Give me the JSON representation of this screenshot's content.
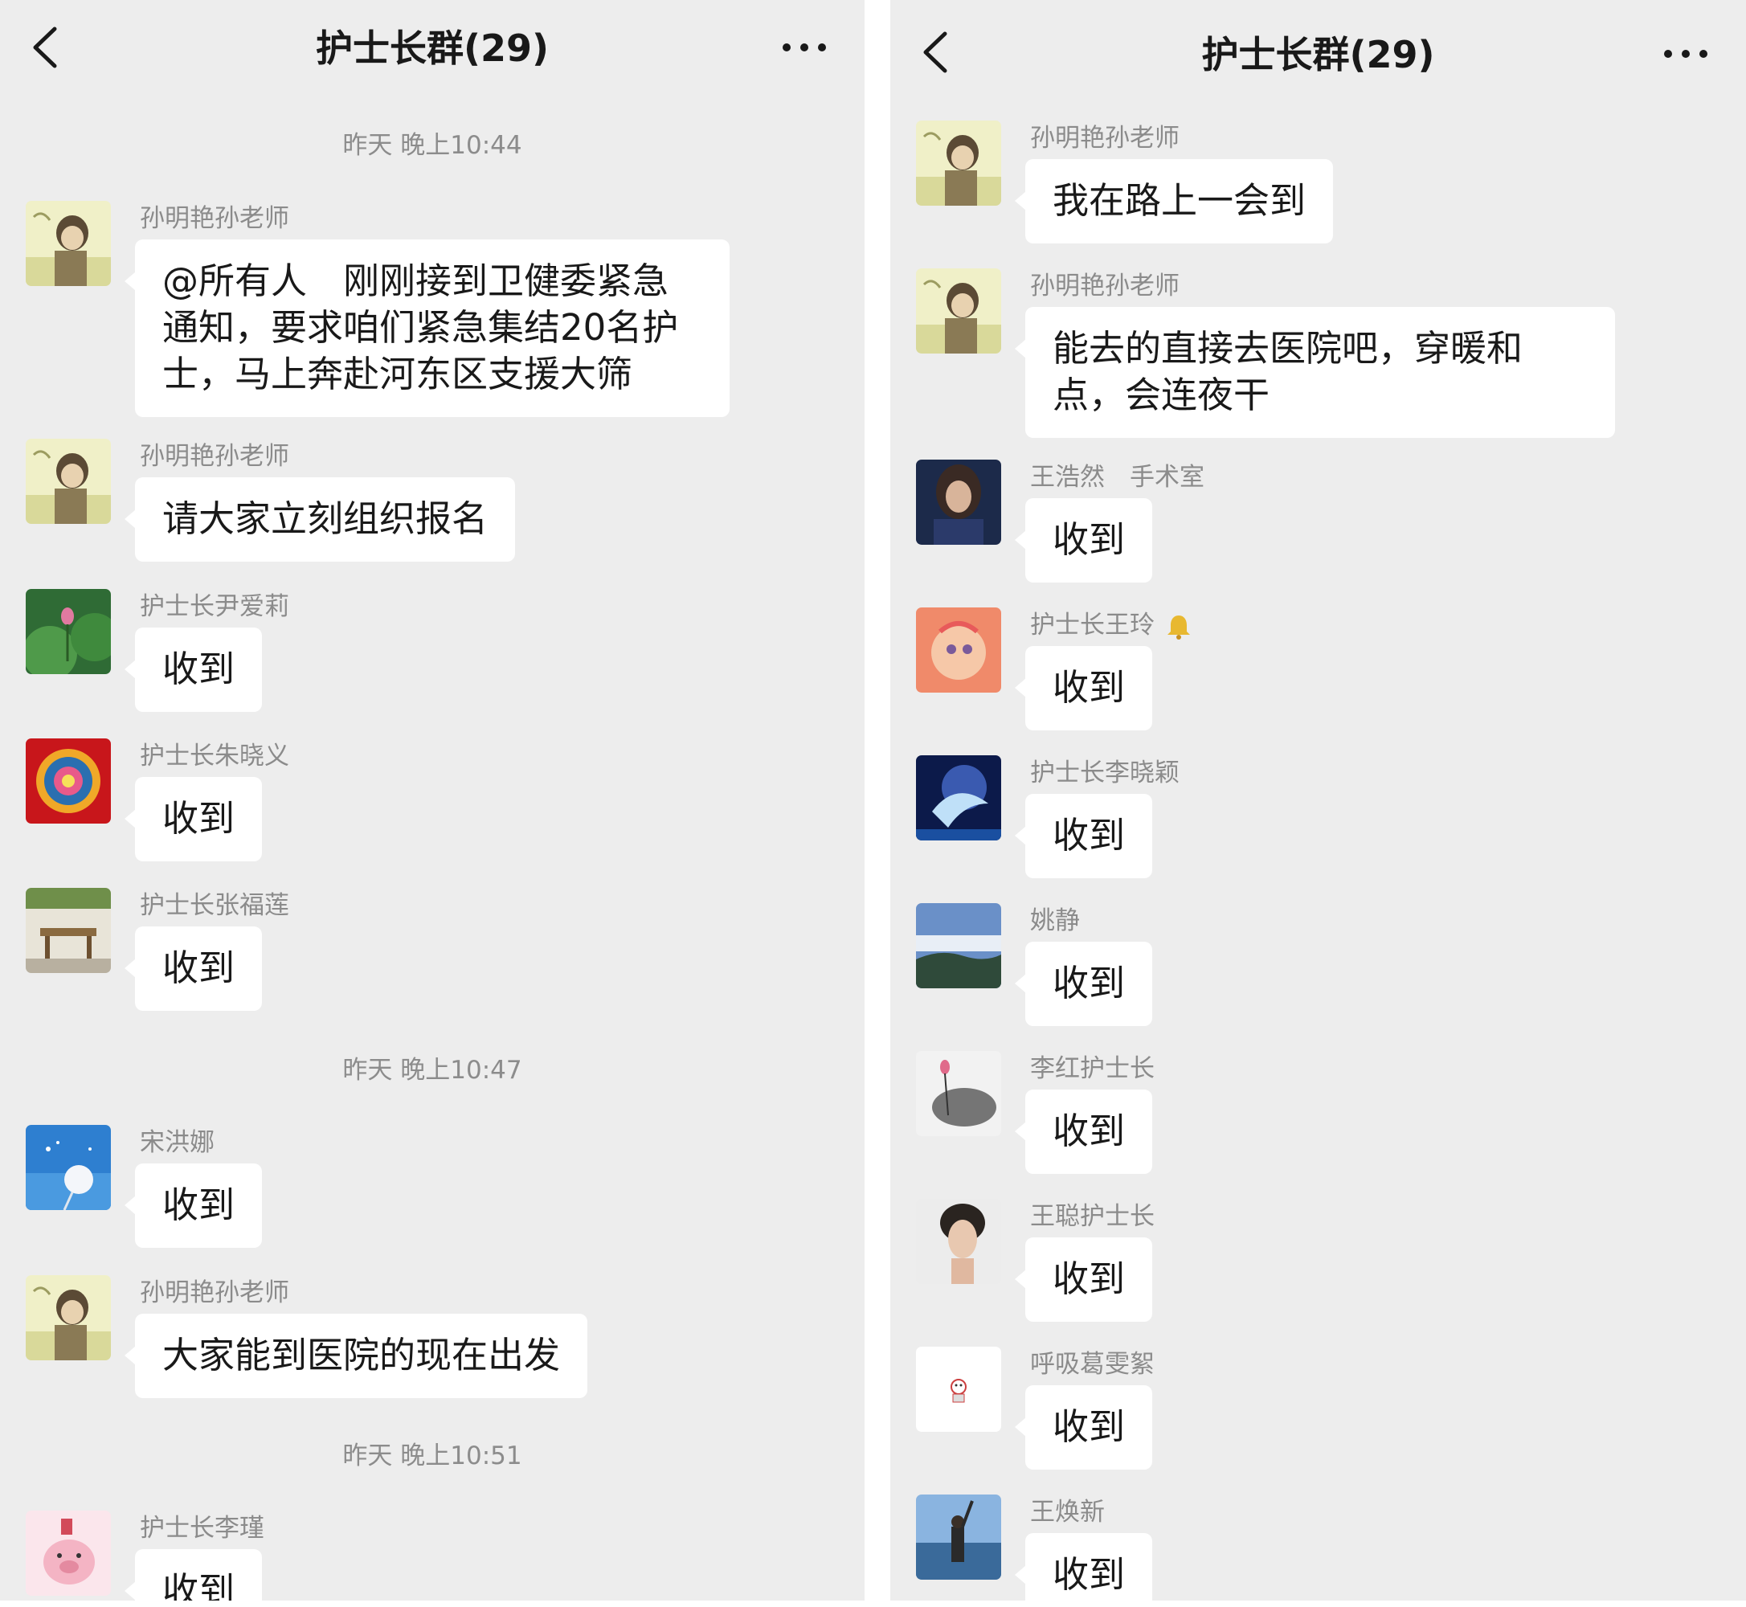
{
  "left": {
    "title": "护士长群(29)",
    "times": [
      "昨天 晚上10:44",
      "昨天 晚上10:47",
      "昨天 晚上10:51"
    ],
    "messages": [
      {
        "sender": "孙明艳孙老师",
        "text": "@所有人　刚刚接到卫健委紧急通知，要求咱们紧急集结20名护士，马上奔赴河东区支援大筛"
      },
      {
        "sender": "孙明艳孙老师",
        "text": "请大家立刻组织报名"
      },
      {
        "sender": "护士长尹爱莉",
        "text": "收到"
      },
      {
        "sender": "护士长朱晓义",
        "text": "收到"
      },
      {
        "sender": "护士长张福莲",
        "text": "收到"
      },
      {
        "sender": "宋洪娜",
        "text": "收到"
      },
      {
        "sender": "孙明艳孙老师",
        "text": "大家能到医院的现在出发"
      },
      {
        "sender": "护士长李瑾",
        "text": "收到"
      }
    ]
  },
  "right": {
    "title": "护士长群(29)",
    "messages": [
      {
        "sender": "孙明艳孙老师",
        "text": "我在路上一会到"
      },
      {
        "sender": "孙明艳孙老师",
        "text": "能去的直接去医院吧，穿暖和点，会连夜干"
      },
      {
        "sender": "王浩然　手术室",
        "text": "收到"
      },
      {
        "sender": "护士长王玲",
        "text": "收到"
      },
      {
        "sender": "护士长李晓颖",
        "text": "收到"
      },
      {
        "sender": "姚静",
        "text": "收到"
      },
      {
        "sender": "李红护士长",
        "text": "收到"
      },
      {
        "sender": "王聪护士长",
        "text": "收到"
      },
      {
        "sender": "呼吸葛雯絮",
        "text": "收到"
      },
      {
        "sender": "王焕新",
        "text": "收到"
      }
    ]
  },
  "icons": {
    "back": "chevron-left-icon",
    "more": "more-dots-icon",
    "bell": "bell-icon"
  },
  "colors": {
    "chat_background": "#ededed",
    "bubble": "#ffffff",
    "sender_name": "#8b8b8b",
    "timestamp": "#8c8c8c"
  }
}
